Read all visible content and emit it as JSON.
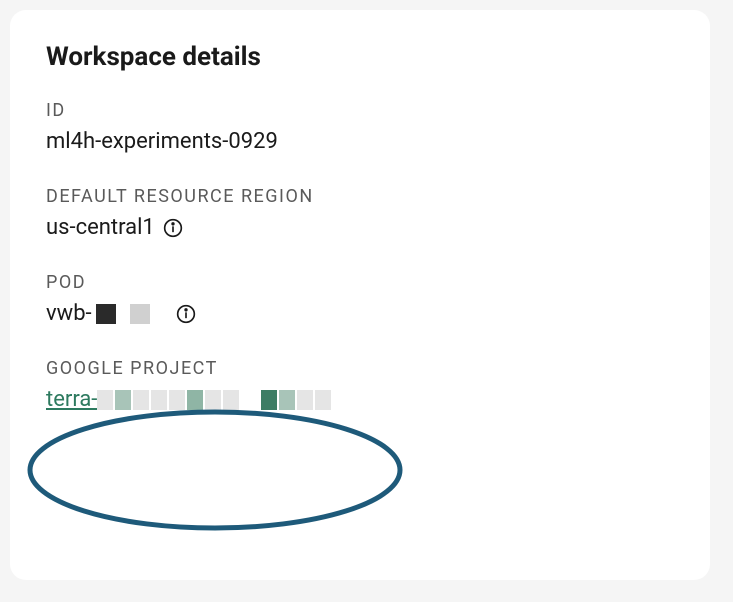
{
  "card": {
    "title": "Workspace details"
  },
  "fields": {
    "id": {
      "label": "ID",
      "value": "ml4h-experiments-0929"
    },
    "region": {
      "label": "DEFAULT RESOURCE REGION",
      "value": "us-central1"
    },
    "pod": {
      "label": "POD",
      "value_prefix": "vwb-"
    },
    "google_project": {
      "label": "GOOGLE PROJECT",
      "value_prefix": "terra-"
    }
  },
  "colors": {
    "link": "#2d7a5f",
    "annotation": "#1e5a7a"
  }
}
